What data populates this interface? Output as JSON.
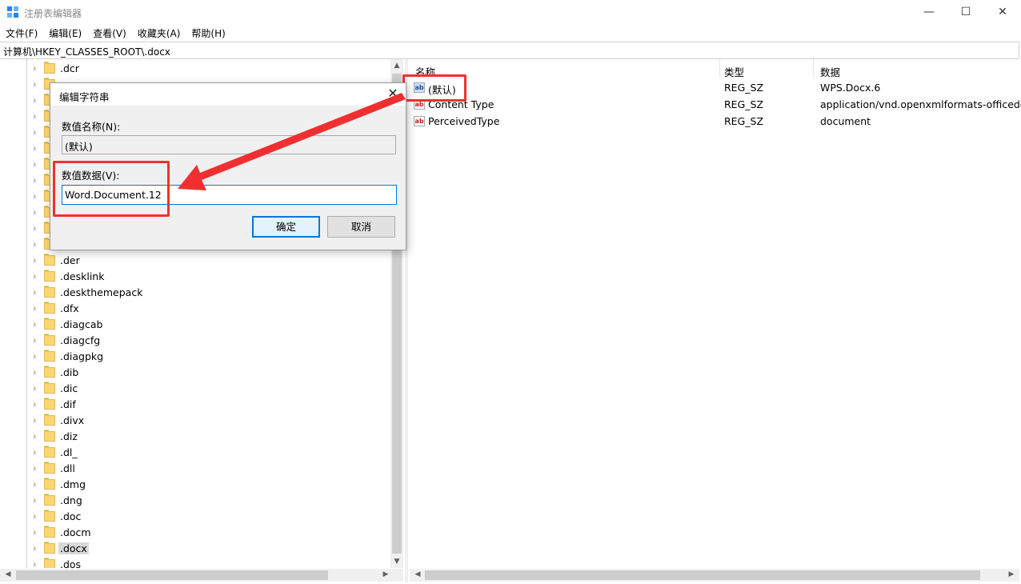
{
  "window": {
    "title": "注册表编辑器",
    "minimize": "—",
    "maximize": "☐",
    "close": "✕"
  },
  "menu": [
    "文件(F)",
    "编辑(E)",
    "查看(V)",
    "收藏夹(A)",
    "帮助(H)"
  ],
  "address": "计算机\\HKEY_CLASSES_ROOT\\.docx",
  "tree": {
    "items": [
      ".dcr",
      ".der",
      ".desklink",
      ".deskthemepack",
      ".dfx",
      ".diagcab",
      ".diagcfg",
      ".diagpkg",
      ".dib",
      ".dic",
      ".dif",
      ".divx",
      ".diz",
      ".dl_",
      ".dll",
      ".dmg",
      ".dng",
      ".doc",
      ".docm",
      ".docx",
      ".dos"
    ],
    "selected": ".docx"
  },
  "list": {
    "headers": {
      "name": "名称",
      "type": "类型",
      "data": "数据"
    },
    "rows": [
      {
        "name": "(默认)",
        "type": "REG_SZ",
        "data": "WPS.Docx.6"
      },
      {
        "name": "Content Type",
        "type": "REG_SZ",
        "data": "application/vnd.openxmlformats-officedoc"
      },
      {
        "name": "PerceivedType",
        "type": "REG_SZ",
        "data": "document"
      }
    ]
  },
  "dialog": {
    "title": "编辑字符串",
    "close": "✕",
    "name_label": "数值名称(N):",
    "name_value": "(默认)",
    "data_label": "数值数据(V):",
    "data_value": "Word.Document.12",
    "ok": "确定",
    "cancel": "取消"
  },
  "colors": {
    "annotation": "#f03030",
    "selection_border": "#0078d7"
  }
}
